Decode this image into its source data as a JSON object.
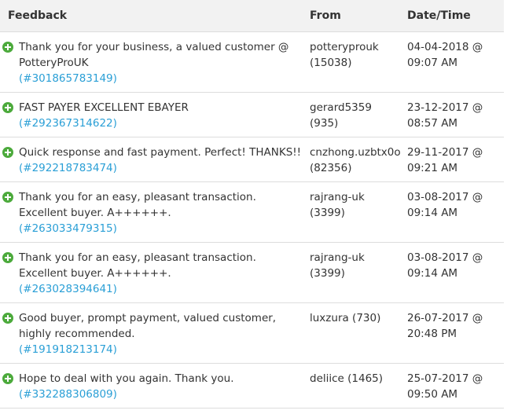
{
  "header": {
    "feedback_label": "Feedback",
    "from_label": "From",
    "date_label": "Date/Time"
  },
  "colors": {
    "positive_icon": "#4caa3c",
    "link": "#2a9fd6",
    "header_bg": "#f2f2f2"
  },
  "rows": [
    {
      "comment": "Thank you for your business, a valued customer @ PotteryProUK",
      "item": "(#301865783149)",
      "from": "potteryprouk (15038)",
      "date": "04-04-2018 @ 09:07 AM",
      "icon": "positive-plus-icon"
    },
    {
      "comment": "FAST PAYER EXCELLENT EBAYER",
      "item": "(#292367314622)",
      "from": "gerard5359 (935)",
      "date": "23-12-2017 @ 08:57 AM",
      "icon": "positive-plus-icon"
    },
    {
      "comment": "Quick response and fast payment. Perfect! THANKS!!",
      "item": "(#292218783474)",
      "from": "cnzhong.uzbtx0o (82356)",
      "date": "29-11-2017 @ 09:21 AM",
      "icon": "positive-plus-icon"
    },
    {
      "comment": "Thank you for an easy, pleasant transaction. Excellent buyer. A++++++.",
      "item": "(#263033479315)",
      "from": "rajrang-uk (3399)",
      "date": "03-08-2017 @ 09:14 AM",
      "icon": "positive-plus-icon"
    },
    {
      "comment": "Thank you for an easy, pleasant transaction. Excellent buyer. A++++++.",
      "item": "(#263028394641)",
      "from": "rajrang-uk (3399)",
      "date": "03-08-2017 @ 09:14 AM",
      "icon": "positive-plus-icon"
    },
    {
      "comment": "Good buyer, prompt payment, valued customer, highly recommended.",
      "item": "(#191918213174)",
      "from": "luxzura (730)",
      "date": "26-07-2017 @ 20:48 PM",
      "icon": "positive-plus-icon"
    },
    {
      "comment": "Hope to deal with you again. Thank you.",
      "item": "(#332288306809)",
      "from": "deliice (1465)",
      "date": "25-07-2017 @ 09:50 AM",
      "icon": "positive-plus-icon"
    }
  ]
}
